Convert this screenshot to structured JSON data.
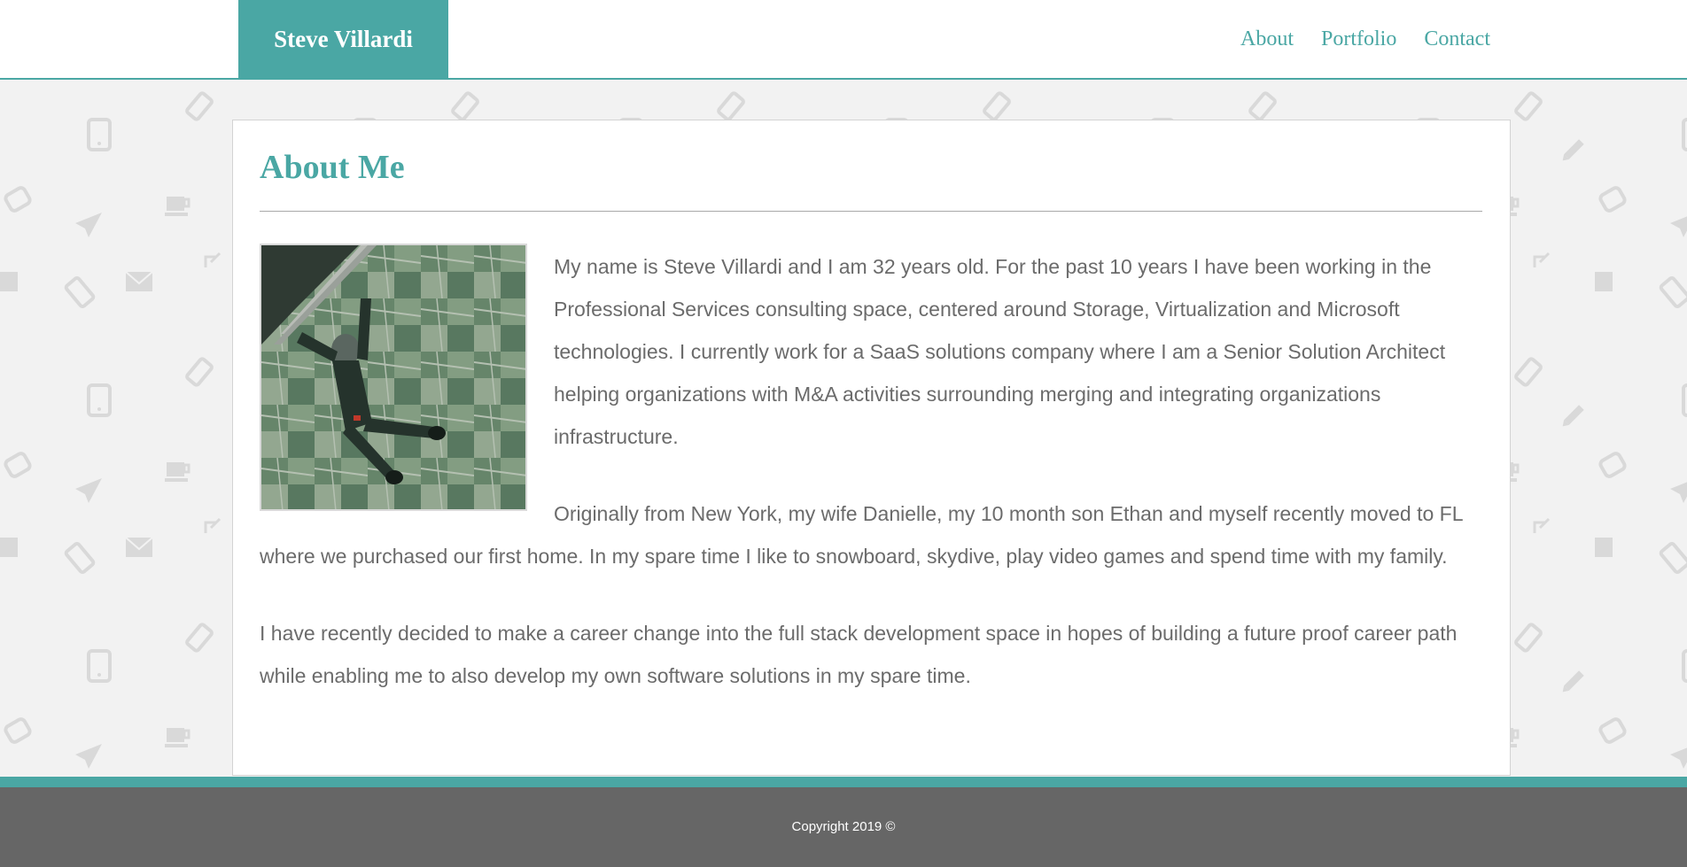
{
  "header": {
    "brand": "Steve Villardi",
    "nav": [
      {
        "label": "About"
      },
      {
        "label": "Portfolio"
      },
      {
        "label": "Contact"
      }
    ]
  },
  "main": {
    "title": "About Me",
    "photo": {
      "icon": "skydiver-photo"
    },
    "paragraphs": [
      "My name is Steve Villardi and I am 32 years old. For the past 10 years I have been working in the Professional Services consulting space, centered around Storage, Virtualization and Microsoft technologies. I currently work for a SaaS solutions company where I am a Senior Solution Architect helping organizations with M&A activities surrounding merging and integrating organizations infrastructure.",
      "Originally from New York, my wife Danielle, my 10 month son Ethan and myself recently moved to FL where we purchased our first home. In my spare time I like to snowboard, skydive, play video games and spend time with my family.",
      "I have recently decided to make a career change into the full stack development space in hopes of building a future proof career path while enabling me to also develop my own software solutions in my spare time."
    ]
  },
  "footer": {
    "copyright": "Copyright 2019 ©"
  },
  "colors": {
    "accent": "#4aa7a4",
    "text": "#6b6b6b",
    "footer_bg": "#666666",
    "page_bg": "#f2f2f2"
  }
}
